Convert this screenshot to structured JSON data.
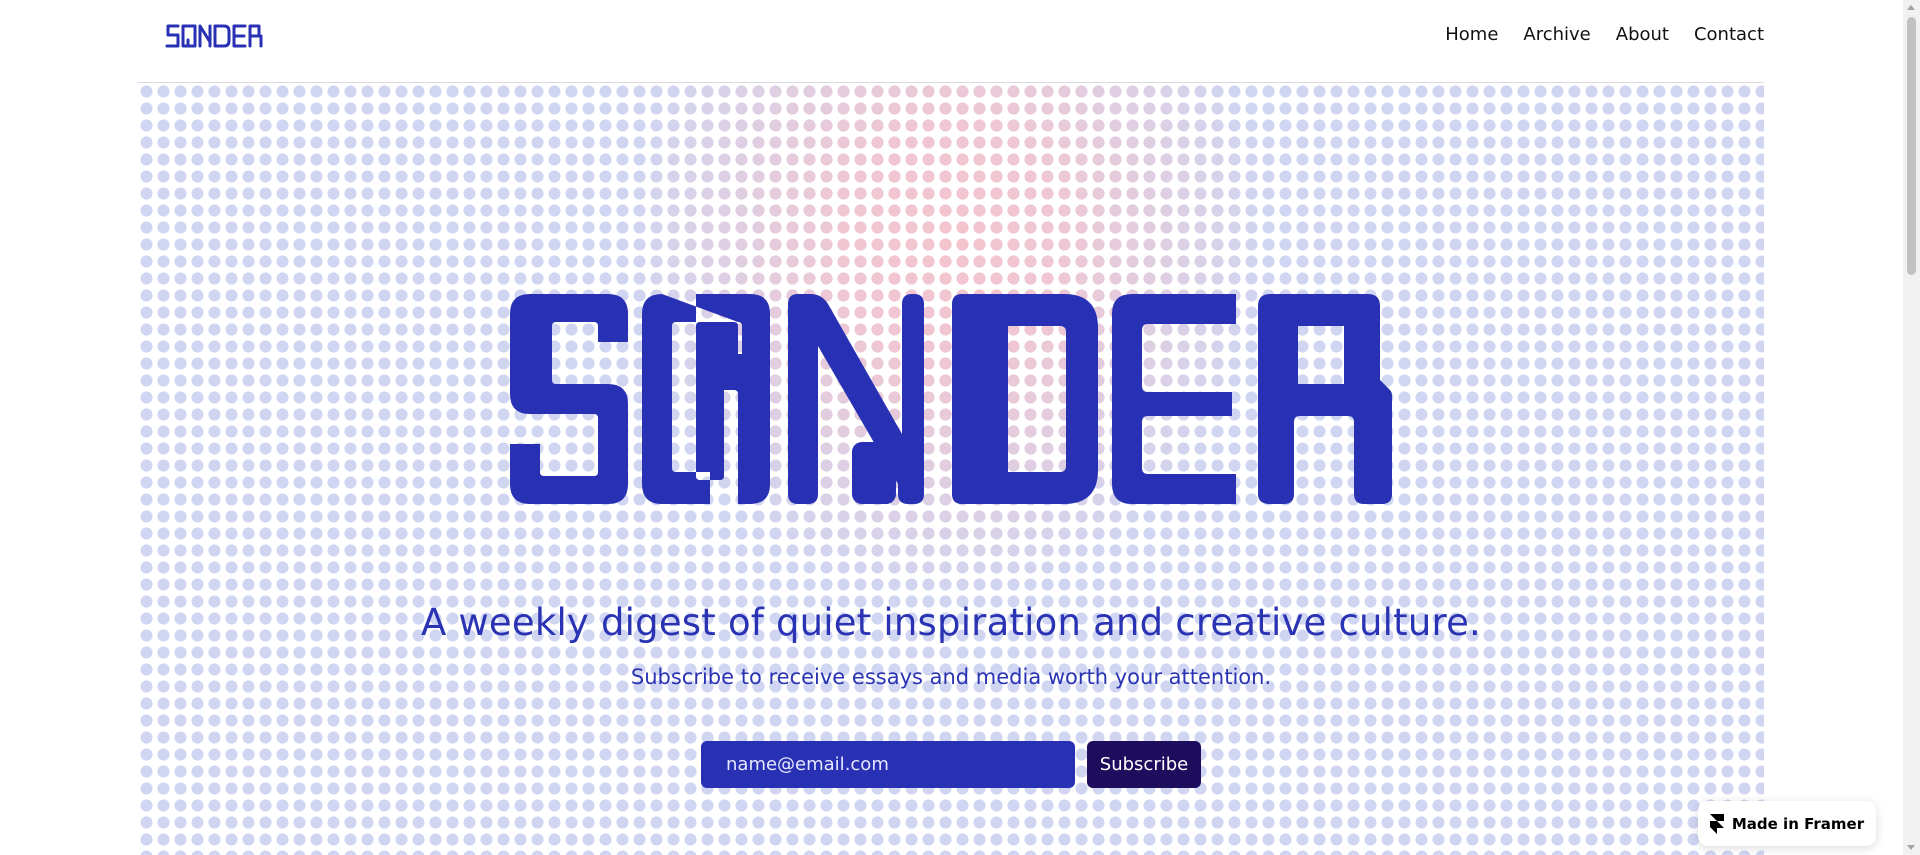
{
  "brand": {
    "name": "SONDER",
    "primary_color": "#2830b3",
    "button_color": "#1d0d5c"
  },
  "header": {
    "logo_text": "SONDER",
    "nav": [
      {
        "label": "Home"
      },
      {
        "label": "Archive"
      },
      {
        "label": "About"
      },
      {
        "label": "Contact"
      }
    ]
  },
  "hero": {
    "wordmark": "SONDER",
    "tagline": "A weekly digest of quiet inspiration and creative culture.",
    "subtagline": "Subscribe to receive essays and media worth your attention.",
    "email_placeholder": "name@email.com",
    "email_value": "",
    "subscribe_label": "Subscribe"
  },
  "badge": {
    "label": "Made in Framer",
    "icon": "framer-logo-icon"
  }
}
